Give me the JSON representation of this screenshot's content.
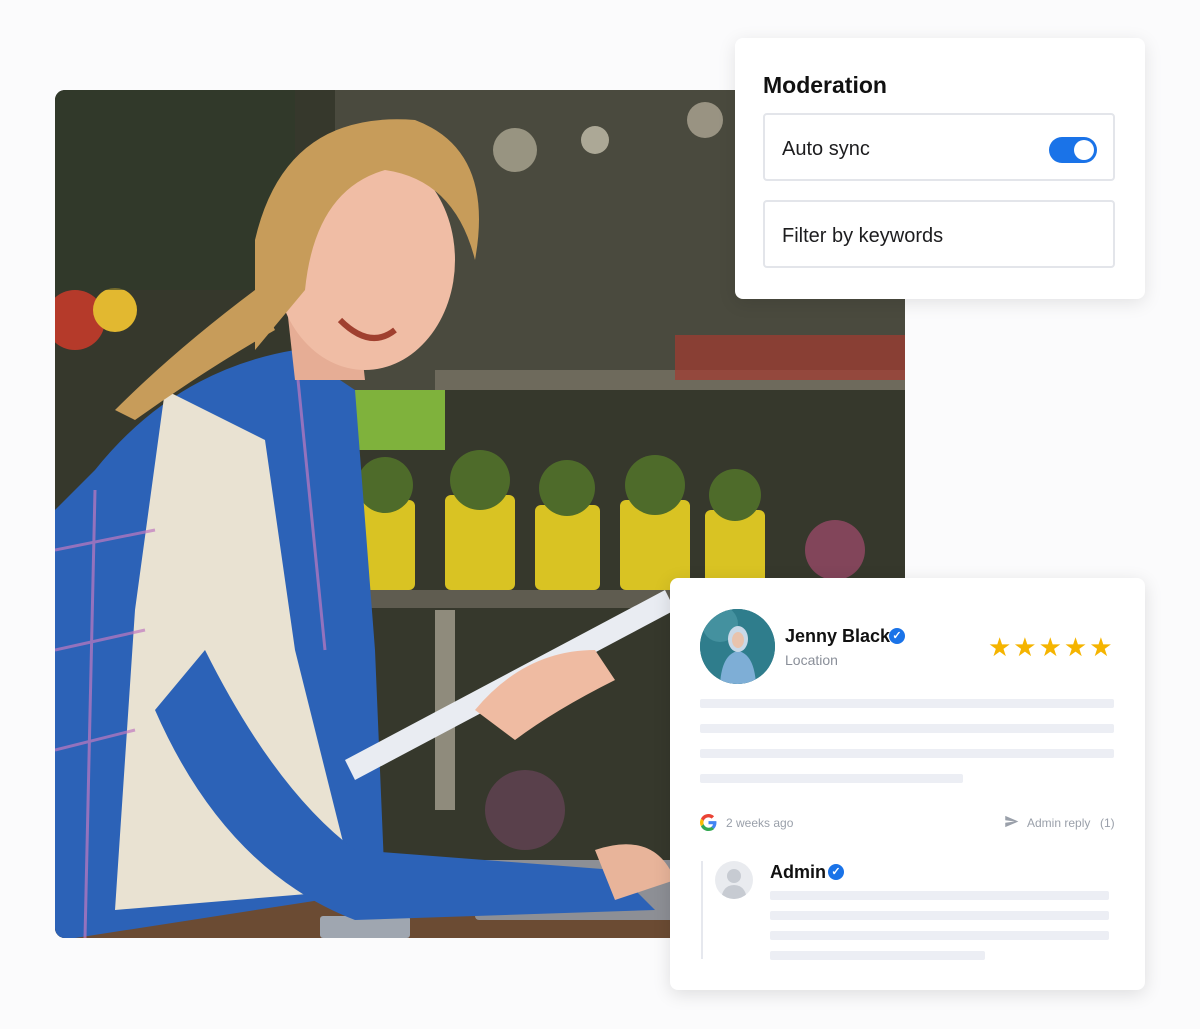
{
  "moderation": {
    "title": "Moderation",
    "auto_sync_label": "Auto sync",
    "auto_sync_enabled": true,
    "filter_label": "Filter by keywords"
  },
  "review": {
    "reviewer_name": "Jenny Black",
    "location": "Location",
    "rating": 5,
    "stars": "★★★★★",
    "time_ago": "2 weeks ago",
    "admin_reply_label": "Admin reply",
    "admin_reply_count": "(1)",
    "reply_author": "Admin"
  },
  "icons": {
    "verified": "verified-badge-icon",
    "source": "google-icon",
    "reply": "send-icon",
    "star": "star-icon",
    "admin_avatar": "user-placeholder-icon"
  },
  "colors": {
    "accent": "#1a73e8",
    "star": "#f5b400",
    "placeholder_bar": "#eceef4"
  }
}
